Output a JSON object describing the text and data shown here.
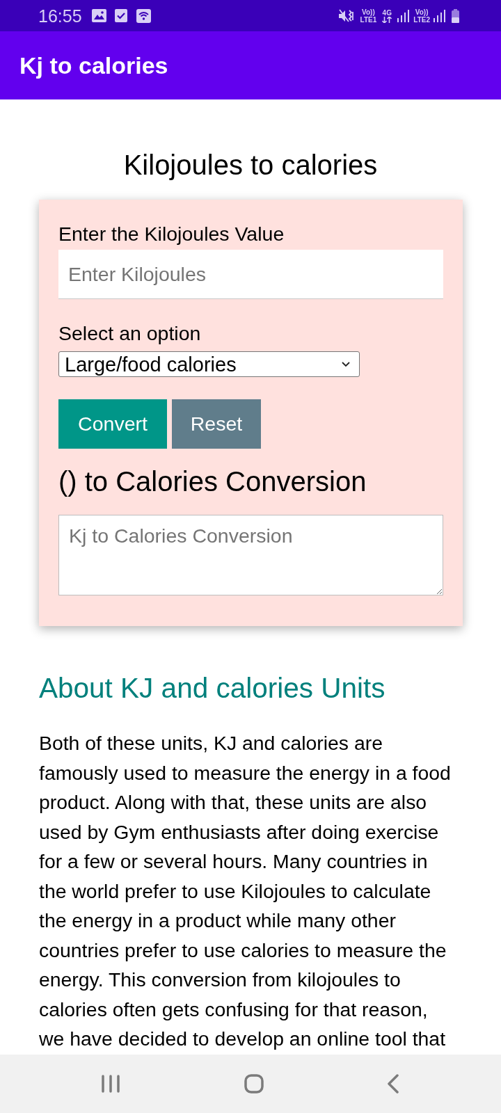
{
  "status_bar": {
    "time": "16:55",
    "sim_1": {
      "volte": "Vo))",
      "network": "LTE1"
    },
    "data_type": "4G",
    "sim_2": {
      "volte": "Vo))",
      "network": "LTE2"
    }
  },
  "app_bar": {
    "title": "Kj to calories"
  },
  "page_title": "Kilojoules to calories",
  "converter": {
    "input_label": "Enter the Kilojoules Value",
    "input": {
      "placeholder": "Enter Kilojoules"
    },
    "select_label": "Select an option",
    "select": {
      "value": "Large/food calories"
    },
    "buttons": [
      {
        "label": "Convert",
        "kind": "primary"
      },
      {
        "label": "Reset",
        "kind": "secondary"
      }
    ],
    "result_heading": "() to Calories Conversion",
    "result": {
      "placeholder": "Kj to Calories Conversion"
    }
  },
  "about": {
    "heading": "About KJ and calories Units",
    "paragraph": "Both of these units, KJ and calories are famously used to measure the energy in a food product. Along with that, these units are also used by Gym enthusiasts after doing exercise for a few or several hours. Many countries in the world prefer to use Kilojoules to calculate the energy in a product while many other countries prefer to use calories to measure the energy. This conversion from kilojoules to calories often gets confusing for that reason, we have decided to develop an online tool that"
  }
}
